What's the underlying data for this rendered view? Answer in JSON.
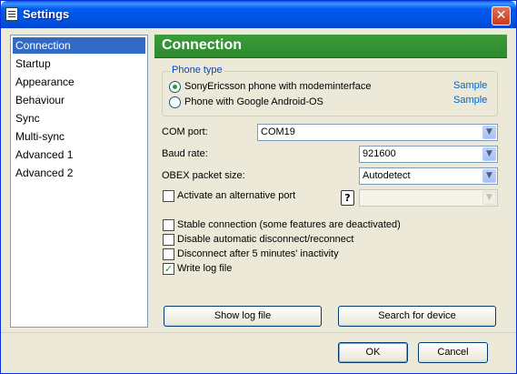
{
  "window": {
    "title": "Settings",
    "close_symbol": "✕"
  },
  "sidebar": {
    "items": [
      {
        "label": "Connection",
        "active": true
      },
      {
        "label": "Startup"
      },
      {
        "label": "Appearance"
      },
      {
        "label": "Behaviour"
      },
      {
        "label": "Sync"
      },
      {
        "label": "Multi-sync"
      },
      {
        "label": "Advanced 1"
      },
      {
        "label": "Advanced 2"
      }
    ]
  },
  "panel": {
    "title": "Connection",
    "phone_type": {
      "legend": "Phone type",
      "options": [
        {
          "label": "SonyEricsson phone with modeminterface",
          "selected": true,
          "link": "Sample"
        },
        {
          "label": "Phone with Google Android-OS",
          "selected": false,
          "link": "Sample"
        }
      ]
    },
    "com_port": {
      "label": "COM port:",
      "value": "COM19"
    },
    "baud_rate": {
      "label": "Baud rate:",
      "value": "921600"
    },
    "obex": {
      "label": "OBEX packet size:",
      "value": "Autodetect"
    },
    "alt_port": {
      "label": "Activate an alternative port",
      "checked": false,
      "help": "?",
      "value": ""
    },
    "options": [
      {
        "label": "Stable connection (some features are deactivated)",
        "checked": false
      },
      {
        "label": "Disable automatic disconnect/reconnect",
        "checked": false
      },
      {
        "label": "Disconnect after 5 minutes' inactivity",
        "checked": false
      },
      {
        "label": "Write log file",
        "checked": true
      }
    ],
    "buttons": {
      "show_log": "Show log file",
      "search_device": "Search for device"
    }
  },
  "footer": {
    "ok": "OK",
    "cancel": "Cancel"
  },
  "icons": {
    "dropdown": "▼",
    "check": "✓"
  },
  "colors": {
    "header_green": "#2e8a2e",
    "title_blue": "#0054e3",
    "selection": "#316ac5",
    "link": "#0066cc"
  }
}
